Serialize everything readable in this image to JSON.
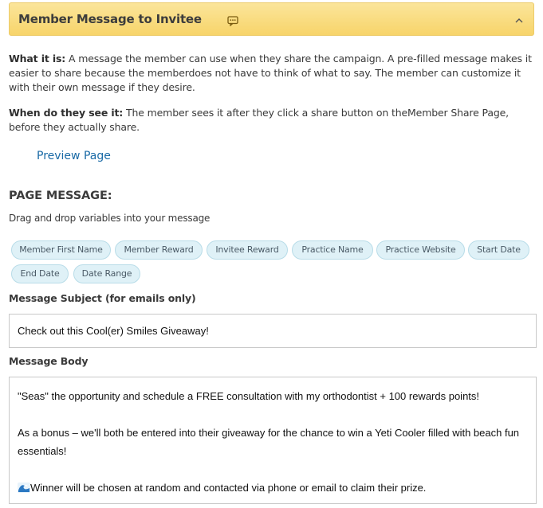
{
  "header": {
    "title": "Member Message to Invitee",
    "message_icon": "message-icon",
    "collapse_icon": "chevron-up-icon",
    "color": "#f7d46a"
  },
  "info": {
    "what_label": "What it is:",
    "what_text": " A message the member can use when they share the campaign. A pre-filled message makes it easier to share because the memberdoes not have to think of what to say. The member can customize it with their own message if they desire.",
    "when_label": "When do they see it:",
    "when_text": " The member sees it after they click a share button on theMember Share Page, before they actually share."
  },
  "preview_link": "Preview Page",
  "page_message": {
    "title": "PAGE MESSAGE:",
    "hint": "Drag and drop variables into your message",
    "variables": [
      "Member First Name",
      "Member Reward",
      "Invitee Reward",
      "Practice Name",
      "Practice Website",
      "Start Date",
      "End Date",
      "Date Range"
    ]
  },
  "subject": {
    "label": "Message Subject (for emails only)",
    "value": "Check out this Cool(er) Smiles Giveaway!"
  },
  "body": {
    "label": "Message Body",
    "line1": "\"Seas\" the opportunity and schedule a FREE consultation with my orthodontist + 100 rewards points!",
    "line2": "As a bonus – we'll both be entered into their giveaway for the chance to win a Yeti Cooler filled with beach fun essentials!",
    "line3": "Winner will be chosen at random and contacted via phone or email to claim their prize.",
    "emoji_icon": "wave-icon"
  }
}
